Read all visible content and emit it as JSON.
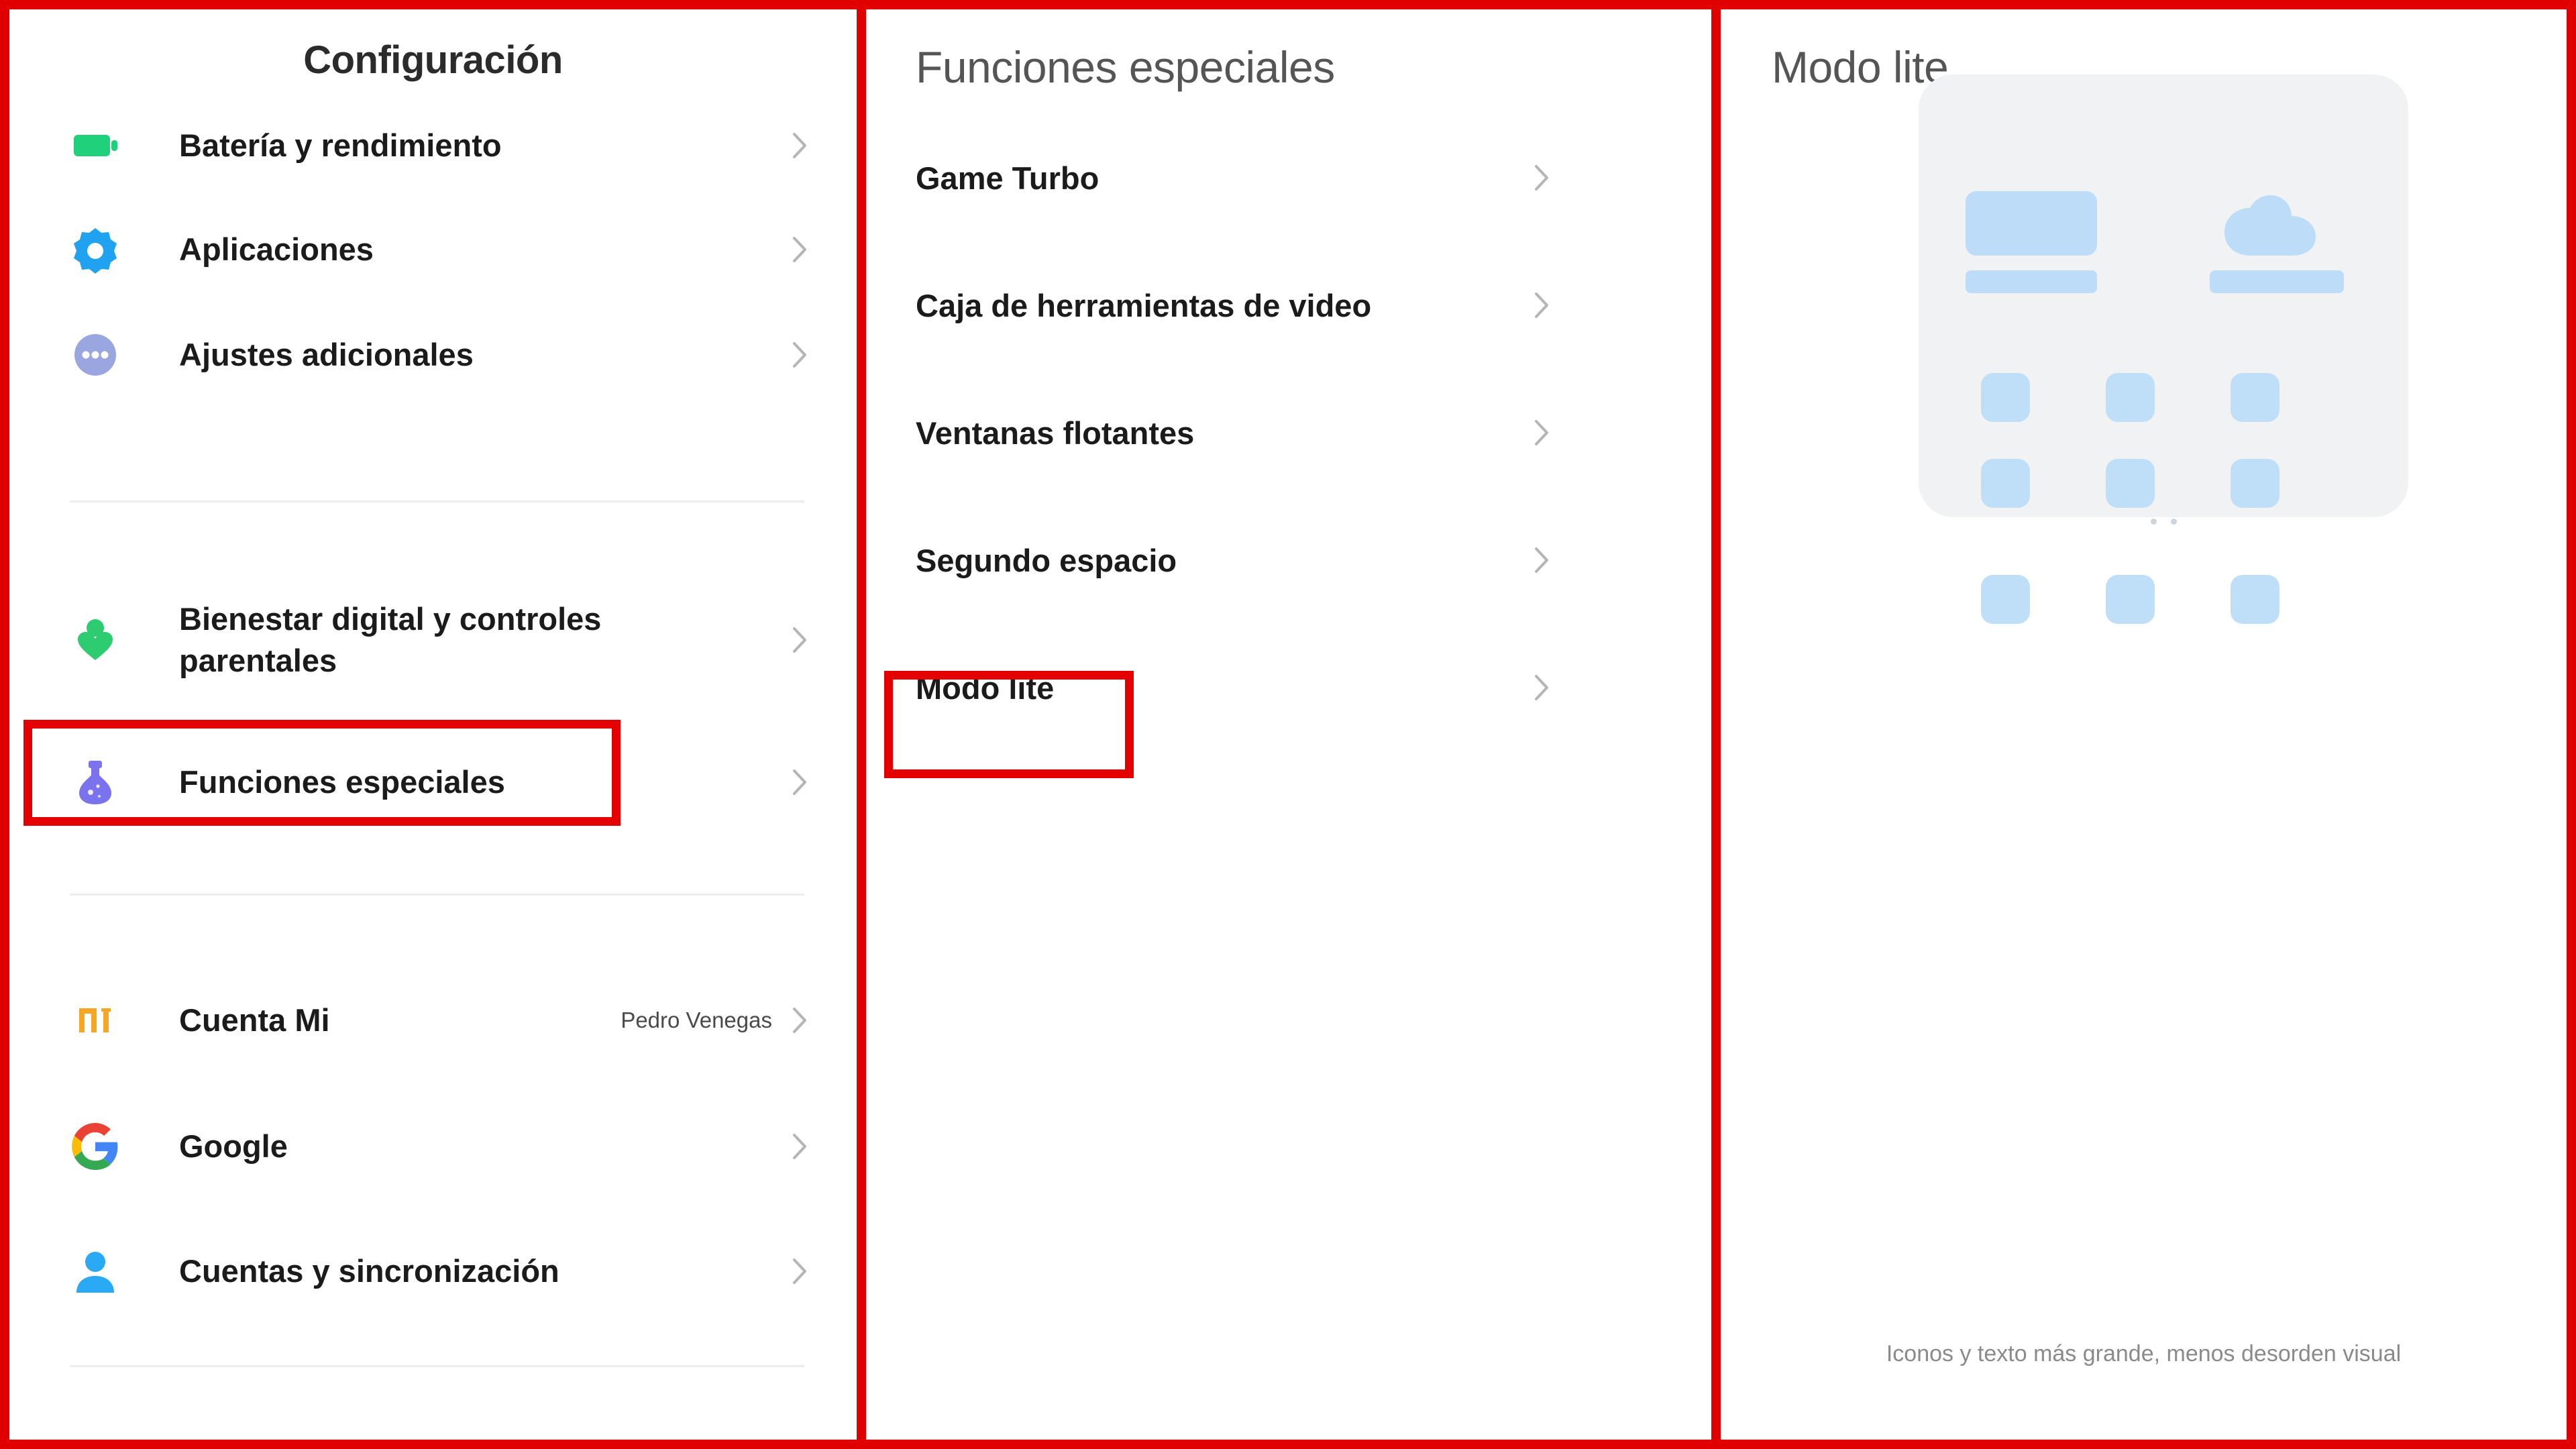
{
  "colors": {
    "highlight_red": "#e40000",
    "frame_red": "#e00000",
    "accent_blue": "#bcdcf7",
    "card_gray": "#f1f2f3",
    "caption_gray": "#8a8a8a"
  },
  "settings_panel": {
    "title": "Configuración",
    "items": [
      {
        "label": "Batería y rendimiento",
        "icon": "battery-icon",
        "value": "",
        "highlighted": false
      },
      {
        "label": "Aplicaciones",
        "icon": "gear-icon",
        "value": "",
        "highlighted": false
      },
      {
        "label": "Ajustes adicionales",
        "icon": "more-dots-icon",
        "value": "",
        "highlighted": false
      },
      {
        "label": "Bienestar digital y controles parentales",
        "icon": "person-heart-icon",
        "value": "",
        "highlighted": false
      },
      {
        "label": "Funciones especiales",
        "icon": "potion-flask-icon",
        "value": "",
        "highlighted": true
      },
      {
        "label": "Cuenta Mi",
        "icon": "mi-logo-icon",
        "value": "Pedro Venegas",
        "highlighted": false
      },
      {
        "label": "Google",
        "icon": "google-logo-icon",
        "value": "",
        "highlighted": false
      },
      {
        "label": "Cuentas y sincronización",
        "icon": "account-person-icon",
        "value": "",
        "highlighted": false
      }
    ]
  },
  "features_panel": {
    "title": "Funciones especiales",
    "items": [
      {
        "label": "Game Turbo",
        "highlighted": false
      },
      {
        "label": "Caja de herramientas de video",
        "highlighted": false
      },
      {
        "label": "Ventanas flotantes",
        "highlighted": false
      },
      {
        "label": "Segundo espacio",
        "highlighted": false
      },
      {
        "label": "Modo lite",
        "highlighted": true
      }
    ]
  },
  "lite_panel": {
    "title": "Modo lite",
    "caption": "Iconos y texto más grande, menos desorden visual",
    "preview": {
      "widget_rect": "widget-placeholder",
      "cloud": "cloud-icon",
      "bars": 2,
      "app_rows": 3,
      "app_columns": 3,
      "page_dots": 2
    }
  }
}
